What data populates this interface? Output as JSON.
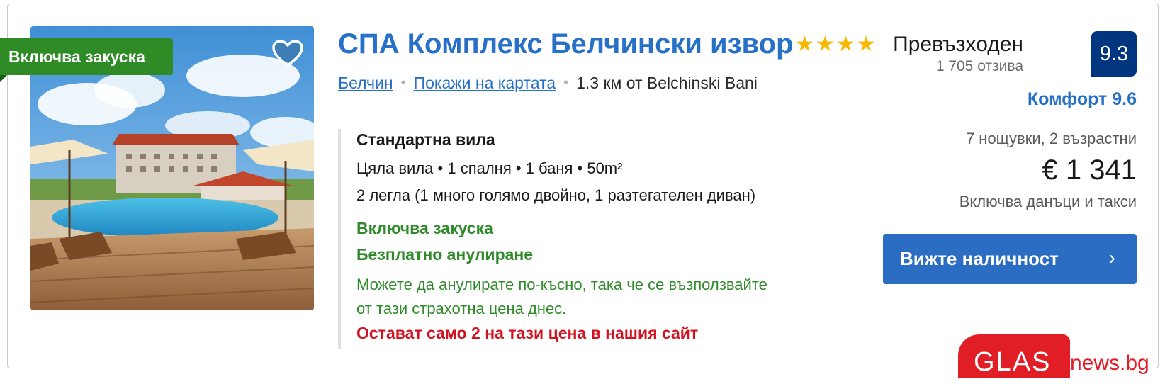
{
  "listing": {
    "badge": "Включва закуска",
    "hotel_name": "СПА Комплекс Белчински извор",
    "stars": 4,
    "location": {
      "town_link": "Белчин",
      "map_link": "Покажи на картата",
      "distance": "1.3 км от Belchinski Bani"
    },
    "room": {
      "name": "Стандартна вила",
      "details": "Цяла вила • 1 спалня • 1 баня • 50m²",
      "beds": "2 легла (1 много голямо двойно, 1 разтегателен диван)",
      "breakfast": "Включва закуска",
      "free_cancel": "Безплатно анулиране",
      "cancel_note": "Можете да анулирате по-късно, така че се възползвайте от тази страхотна цена днес.",
      "scarcity": "Остават само 2 на тази цена в нашия сайт"
    },
    "review": {
      "word": "Превъзходен",
      "count": "1 705 отзива",
      "score": "9.3",
      "comfort": "Комфорт 9.6"
    },
    "pricing": {
      "stay": "7 нощувки, 2 възрастни",
      "price": "€ 1 341",
      "taxes": "Включва данъци и такси"
    },
    "cta_label": "Вижте наличност",
    "colors": {
      "link_blue": "#2770c7",
      "score_navy": "#003580",
      "badge_green": "#2e8b26",
      "star_yellow": "#f6b800",
      "scarcity_red": "#d4111e"
    }
  },
  "watermark": {
    "brand": "GLAS",
    "domain": "news.bg"
  }
}
